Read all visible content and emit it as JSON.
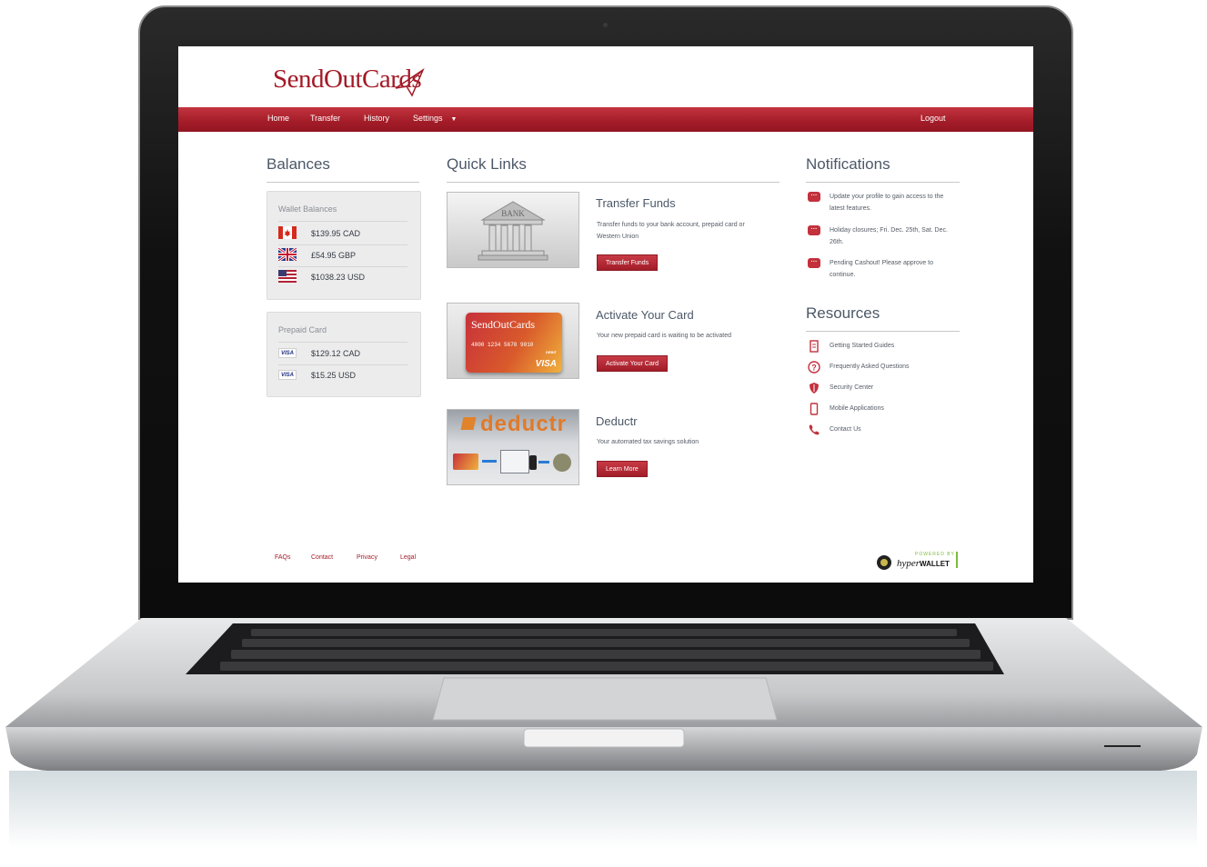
{
  "brand": {
    "name_part1": "Send",
    "name_part2": "OutCards",
    "color": "#a31c28"
  },
  "nav": {
    "items": [
      "Home",
      "Transfer",
      "History",
      "Settings"
    ],
    "logout": "Logout"
  },
  "balances": {
    "heading": "Balances",
    "wallet": {
      "title": "Wallet Balances",
      "rows": [
        {
          "flag": "canada-flag-icon",
          "amount": "$139.95 CAD"
        },
        {
          "flag": "uk-flag-icon",
          "amount": "£54.95 GBP"
        },
        {
          "flag": "us-flag-icon",
          "amount": "$1038.23 USD"
        }
      ]
    },
    "prepaid": {
      "title": "Prepaid Card",
      "card_brand": "VISA",
      "rows": [
        {
          "amount": "$129.12 CAD"
        },
        {
          "amount": "$15.25 USD"
        }
      ]
    }
  },
  "quick_links": {
    "heading": "Quick Links",
    "items": [
      {
        "title": "Transfer Funds",
        "desc": "Transfer funds to your bank account, prepaid card or Western Union",
        "button": "Transfer Funds",
        "image_label": "BANK"
      },
      {
        "title": "Activate Your Card",
        "desc": "Your new prepaid card is waiting to be activated",
        "button": "Activate Your Card",
        "image_label": "SendOutCards",
        "card_number": "4000 1234 5678 9010",
        "card_brand": "VISA",
        "card_type": "DEBIT"
      },
      {
        "title": "Deductr",
        "desc": "Your automated tax savings solution",
        "button": "Learn More",
        "image_label": "deductr"
      }
    ]
  },
  "notifications": {
    "heading": "Notifications",
    "items": [
      "Update your profile to gain access to the latest features.",
      "Holiday closures; Fri. Dec. 25th, Sat. Dec. 26th.",
      "Pending Cashout! Please approve to continue."
    ]
  },
  "resources": {
    "heading": "Resources",
    "items": [
      {
        "icon": "guide-icon",
        "label": "Getting Started Guides"
      },
      {
        "icon": "question-icon",
        "label": "Frequently Asked Questions"
      },
      {
        "icon": "shield-icon",
        "label": "Security Center"
      },
      {
        "icon": "mobile-icon",
        "label": "Mobile Applications"
      },
      {
        "icon": "phone-icon",
        "label": "Contact Us"
      }
    ]
  },
  "footer": {
    "links": [
      "FAQs",
      "Contact",
      "Privacy",
      "Legal"
    ],
    "powered_by": "POWERED BY",
    "hyper": "hyper",
    "wallet": "WALLET"
  }
}
